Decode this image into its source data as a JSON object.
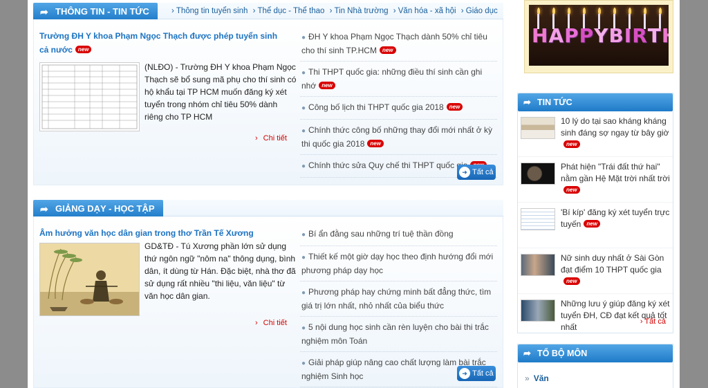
{
  "section1": {
    "tab_label": "THÔNG TIN - TIN TỨC",
    "categories": [
      "Thông tin tuyển sinh",
      "Thể dục - Thể thao",
      "Tin Nhà trường",
      "Văn hóa - xã hội",
      "Giáo dục"
    ],
    "featured": {
      "title": "Trường ĐH Y khoa Phạm Ngọc Thạch được phép tuyển sinh cả nước",
      "description": "(NLĐO) - Trường ĐH Y khoa Phạm Ngọc Thạch sẽ bổ sung mã phụ cho thí sinh có hộ khẩu tại TP HCM muốn đăng ký xét tuyển trong nhóm chỉ tiêu 50% dành riêng cho TP HCM",
      "more_label": "Chi tiết"
    },
    "list": [
      {
        "text": "ĐH Y khoa Phạm Ngọc Thạch dành 50% chỉ tiêu cho thí sinh TP.HCM",
        "new": true
      },
      {
        "text": "Thi THPT quốc gia: những điều thí sinh cần ghi nhớ",
        "new": true
      },
      {
        "text": "Công bố lịch thi THPT quốc gia 2018",
        "new": true
      },
      {
        "text": "Chính thức công bố những thay đổi mới nhất ở kỳ thi quốc gia 2018",
        "new": true
      },
      {
        "text": "Chính thức sửa Quy chế thi THPT quốc gia",
        "new": true
      }
    ],
    "all_label": "Tất cả"
  },
  "section2": {
    "tab_label": "GIẢNG DẠY - HỌC TẬP",
    "featured": {
      "title": "Âm hưởng văn học dân gian trong thơ Trần Tế Xương",
      "description": "GD&TĐ - Tú Xương phần lớn sử dụng thứ ngôn ngữ \"nôm na\" thông dụng, bình dân, ít dùng từ Hán. Đặc biệt, nhà thơ đã sử dụng rất nhiều \"thi liệu, văn liệu\" từ văn học dân gian.",
      "more_label": "Chi tiết"
    },
    "list": [
      {
        "text": "Bí ẩn đằng sau những trí tuệ thần đồng"
      },
      {
        "text": "Thiết kế một giờ dạy học theo định hướng đổi mới phương pháp dạy học"
      },
      {
        "text": "Phương pháp hay chứng minh bất đẳng thức, tìm giá trị lớn nhất, nhỏ nhất của biểu thức"
      },
      {
        "text": "5 nội dung học sinh cần rèn luyện cho bài thi trắc nghiệm môn Toán"
      },
      {
        "text": "Giải pháp giúp nâng cao chất lượng làm bài trắc nghiệm Sinh học"
      }
    ],
    "all_label": "Tất cả"
  },
  "banner": {
    "text": "HAPPY BIRTHDAY"
  },
  "news_box": {
    "tab_label": "TIN TỨC",
    "items": [
      {
        "text": "10 lý do tại sao kháng kháng sinh đáng sợ ngay từ bây giờ",
        "new": true
      },
      {
        "text": "Phát hiện \"Trái đất thứ hai\" nằm gần Hệ Mặt trời nhất trời",
        "new": true
      },
      {
        "text": "'Bí kíp' đăng ký xét tuyển trực tuyến",
        "new": true
      },
      {
        "text": "Nữ sinh duy nhất ở Sài Gòn đạt điểm 10 THPT quốc gia",
        "new": true
      },
      {
        "text": "Những lưu ý giúp đăng ký xét tuyển ĐH, CĐ đạt kết quả tốt nhất",
        "new": false
      }
    ],
    "all_label": "Tất cả"
  },
  "subject_box": {
    "tab_label": "TỔ BỘ MÔN",
    "items": [
      "Văn"
    ]
  },
  "new_badge": "new",
  "colors": {
    "accent": "#1f7bc8",
    "link": "#1c73c2",
    "more": "#d40000",
    "badge": "#d90000"
  }
}
